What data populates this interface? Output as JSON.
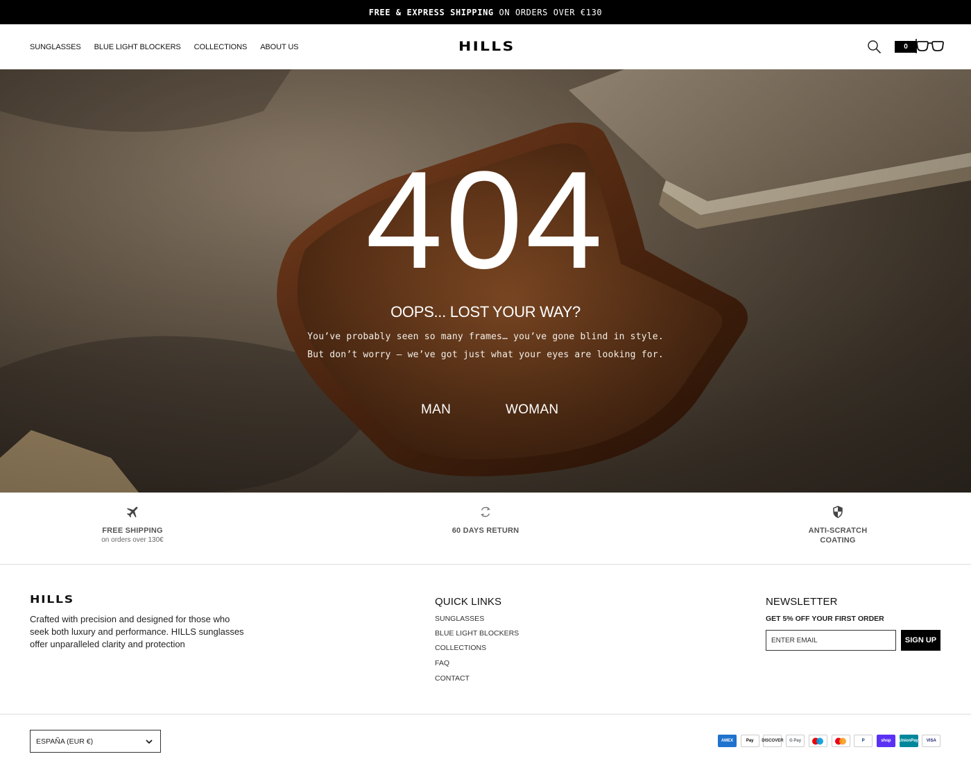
{
  "announcement": {
    "part1": "FREE & EXPRESS SHIPPING",
    "part2": " ON ORDERS OVER €130"
  },
  "header": {
    "nav": [
      "SUNGLASSES",
      "BLUE LIGHT BLOCKERS",
      "COLLECTIONS",
      "ABOUT US"
    ],
    "logo": "HILLS",
    "cart_count": "0",
    "icons": [
      "search-icon",
      "glasses-icon"
    ]
  },
  "hero": {
    "code": "404",
    "title": "OOPS... LOST YOUR WAY?",
    "line1": "You’ve probably seen so many frames… you’ve gone blind in style.",
    "line2": "But don’t worry – we’ve got just what your eyes are looking for.",
    "button_man": "MAN",
    "button_woman": "WOMAN"
  },
  "features": [
    {
      "icon": "airplane-icon",
      "title": "FREE SHIPPING",
      "subtitle": "on orders over 130€"
    },
    {
      "icon": "refresh-icon",
      "title": "60 DAYS RETURN",
      "subtitle": ""
    },
    {
      "icon": "shield-icon",
      "title_line1": "ANTI-SCRATCH",
      "title_line2": "COATING"
    }
  ],
  "footer": {
    "logo": "HILLS",
    "description": "Crafted with precision and designed for those who seek both luxury and performance. HILLS sunglasses offer unparalleled clarity and protection",
    "quick_links_title": "QUICK LINKS",
    "quick_links": [
      "SUNGLASSES",
      "BLUE LIGHT BLOCKERS",
      "COLLECTIONS",
      "FAQ",
      "CONTACT"
    ],
    "newsletter_title": "NEWSLETTER",
    "newsletter_subtitle": "GET 5% OFF YOUR FIRST ORDER",
    "email_placeholder": "ENTER EMAIL",
    "signup_label": "SIGN UP"
  },
  "bottom": {
    "country": "ESPAÑA (EUR €)",
    "payments": [
      {
        "name": "AMEX",
        "bg": "#1f72cd",
        "fg": "#ffffff"
      },
      {
        "name": "Pay",
        "bg": "#ffffff",
        "fg": "#000000"
      },
      {
        "name": "DISCOVER",
        "bg": "#ffffff",
        "fg": "#222222"
      },
      {
        "name": "G Pay",
        "bg": "#ffffff",
        "fg": "#5f6368"
      },
      {
        "name": "maestro",
        "bg": "#ffffff",
        "fg": "#000000"
      },
      {
        "name": "mastercard",
        "bg": "#ffffff",
        "fg": "#000000"
      },
      {
        "name": "P",
        "bg": "#ffffff",
        "fg": "#003087"
      },
      {
        "name": "shop",
        "bg": "#5a31f4",
        "fg": "#ffffff"
      },
      {
        "name": "UnionPay",
        "bg": "#00879b",
        "fg": "#ffffff"
      },
      {
        "name": "VISA",
        "bg": "#ffffff",
        "fg": "#1a1f71"
      }
    ]
  }
}
